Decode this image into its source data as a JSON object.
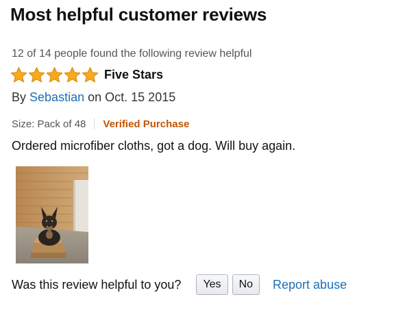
{
  "section": {
    "heading": "Most helpful customer reviews"
  },
  "review": {
    "helpful_count_text": "12 of 14 people found the following review helpful",
    "rating": 5,
    "rating_max": 5,
    "title": "Five Stars",
    "by_prefix": "By",
    "author": "Sebastian",
    "date_prefix": "on",
    "date": "Oct. 15 2015",
    "size": "Size: Pack of 48",
    "verified": "Verified Purchase",
    "body": "Ordered microfiber cloths, got a dog. Will buy again.",
    "photo_icon": "dog-in-box-photo"
  },
  "feedback": {
    "question": "Was this review helpful to you?",
    "yes_label": "Yes",
    "no_label": "No",
    "report_label": "Report abuse"
  },
  "colors": {
    "star": "#f8a91d",
    "link": "#1a6fb5",
    "verified": "#c45500"
  }
}
